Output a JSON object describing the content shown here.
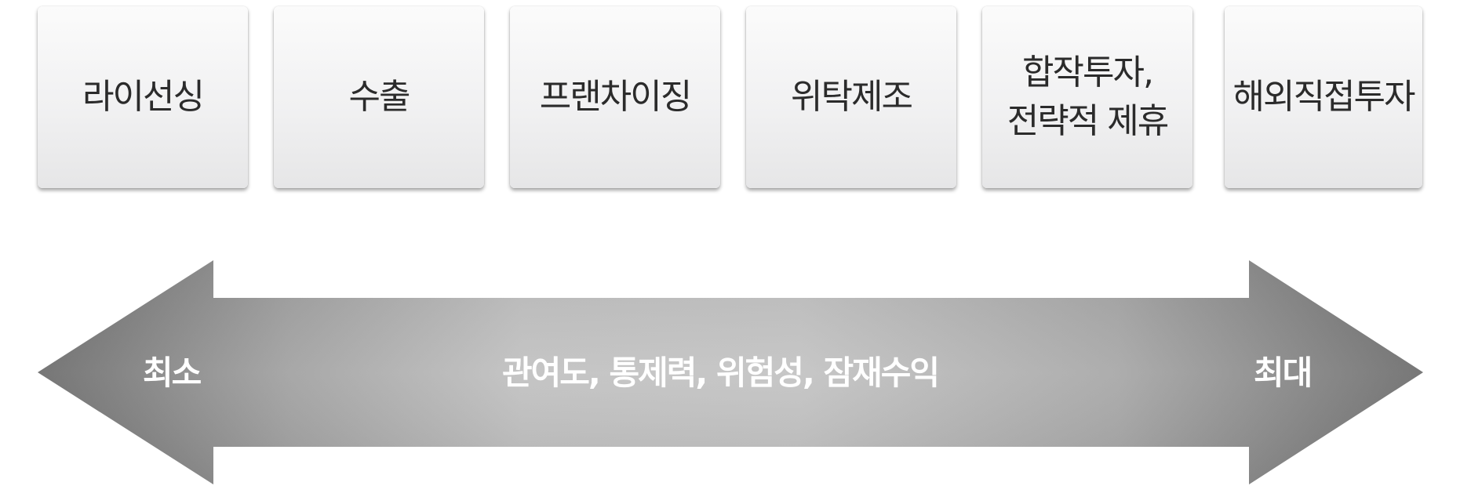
{
  "modes": [
    {
      "label": "라이선싱"
    },
    {
      "label": "수출"
    },
    {
      "label": "프랜차이징"
    },
    {
      "label": "위탁제조"
    },
    {
      "label": "합작투자,\n전략적 제휴"
    },
    {
      "label": "해외직접투자"
    }
  ],
  "scale": {
    "min_label": "최소",
    "center_label": "관여도, 통제력, 위험성, 잠재수익",
    "max_label": "최대"
  },
  "colors": {
    "box_text": "#2b2b2b",
    "arrow_dark": "#6f6f6f",
    "arrow_light": "#c4c4c4",
    "arrow_text": "#ffffff"
  }
}
